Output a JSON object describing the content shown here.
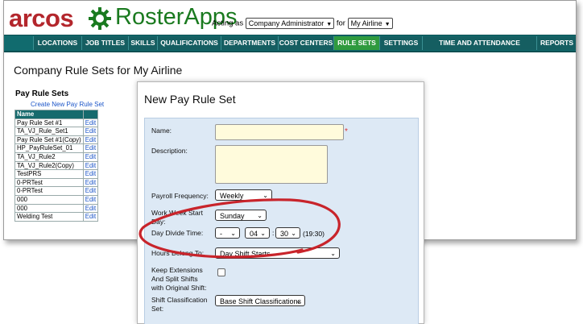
{
  "header": {
    "brand": "arcos",
    "product": "RosterApps",
    "acting_as_label": "Acting as",
    "role_value": "Company Administrator",
    "for_label": "for",
    "company_value": "My Airline"
  },
  "nav": {
    "tabs": [
      "LOCATIONS",
      "JOB TITLES",
      "SKILLS",
      "QUALIFICATIONS",
      "DEPARTMENTS",
      "COST CENTERS",
      "RULE SETS",
      "SETTINGS",
      "TIME AND ATTENDANCE SETTINGS",
      "REPORTS"
    ],
    "active": "RULE SETS"
  },
  "page": {
    "title": "Company Rule Sets for My Airline"
  },
  "pay_rules": {
    "title": "Pay Rule Sets",
    "create_link": "Create New Pay Rule Set",
    "column_name": "Name",
    "edit_label": "Edit",
    "rows": [
      "Pay Rule Set #1",
      "TA_VJ_Rule_Set1",
      "Pay Rule Set #1(Copy)",
      "HP_PayRuleSet_01",
      "TA_VJ_Rule2",
      "TA_VJ_Rule2(Copy)",
      "TestPRS",
      "0-PRTest",
      "0-PRTest",
      "000",
      "000",
      "Welding Test"
    ]
  },
  "dialog": {
    "title": "New Pay Rule Set",
    "name_label": "Name:",
    "name_value": "",
    "required_mark": "*",
    "description_label": "Description:",
    "payroll_frequency_label": "Payroll Frequency:",
    "payroll_frequency_value": "Weekly",
    "work_week_label": "Work Week Start Day:",
    "work_week_value": "Sunday",
    "day_divide_label": "Day Divide Time:",
    "day_divide_sign": "-",
    "day_divide_hour": "04",
    "day_divide_colon": ":",
    "day_divide_minute": "30",
    "day_divide_display": "(19:30)",
    "hours_belong_label": "Hours Belong To:",
    "hours_belong_value": "Day Shift Starts",
    "keep_extensions_label": "Keep Extensions And Split Shifts with Original Shift:",
    "shift_class_label": "Shift Classification Set:",
    "shift_class_value": "Base Shift Classifications"
  },
  "colors": {
    "nav_bg": "#116b6e",
    "active_tab": "#2f9a3e",
    "brand_red": "#b3262c",
    "product_green": "#1a7a1f",
    "annotation": "#c8242b"
  }
}
